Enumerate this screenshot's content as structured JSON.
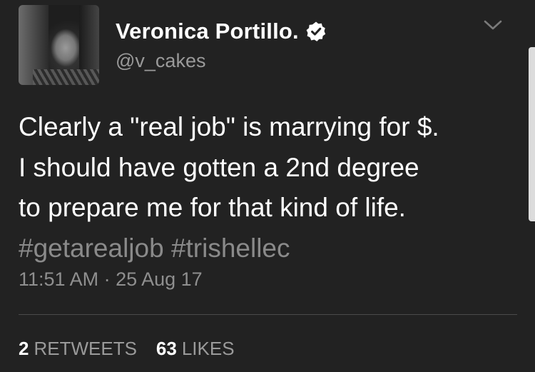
{
  "user": {
    "name": "Veronica Portillo.",
    "handle": "@v_cakes",
    "verified": true,
    "avatar_icon": "profile-photo"
  },
  "tweet": {
    "lines": [
      "Clearly a \"real job\" is marrying for $.",
      "I should have gotten a 2nd degree",
      "to prepare me for that kind of life."
    ],
    "hashtags": "#getarealjob #trishellec",
    "timestamp": "11:51 AM · 25 Aug 17"
  },
  "stats": {
    "retweets_count": "2",
    "retweets_label": "RETWEETS",
    "likes_count": "63",
    "likes_label": "LIKES"
  },
  "icons": {
    "verified": "verified-badge-icon",
    "menu": "chevron-down-icon"
  },
  "colors": {
    "background": "#222222",
    "text": "#ffffff",
    "muted": "#8f8f8f"
  }
}
